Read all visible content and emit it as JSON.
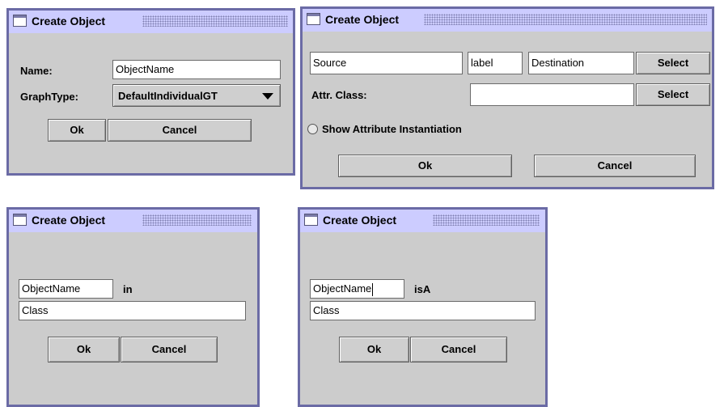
{
  "dialogs": {
    "general": {
      "title": "Create Object",
      "name_label": "Name:",
      "name_value": "ObjectName",
      "graphtype_label": "GraphType:",
      "graphtype_value": "DefaultIndividualGT",
      "ok": "Ok",
      "cancel": "Cancel"
    },
    "attribute": {
      "title": "Create Object",
      "source_value": "Source",
      "label_value": "label",
      "destination_value": "Destination",
      "select1": "Select",
      "attr_class_label": "Attr. Class:",
      "attr_class_value": "",
      "select2": "Select",
      "show_attr_label": "Show Attribute Instantiation",
      "show_attr_checked": false,
      "ok": "Ok",
      "cancel": "Cancel"
    },
    "instance": {
      "title": "Create Object",
      "object_value": "ObjectName",
      "relation_label": "in",
      "class_value": "Class",
      "ok": "Ok",
      "cancel": "Cancel"
    },
    "isa": {
      "title": "Create Object",
      "object_value": "ObjectName",
      "relation_label": "isA",
      "class_value": "Class",
      "ok": "Ok",
      "cancel": "Cancel"
    }
  }
}
